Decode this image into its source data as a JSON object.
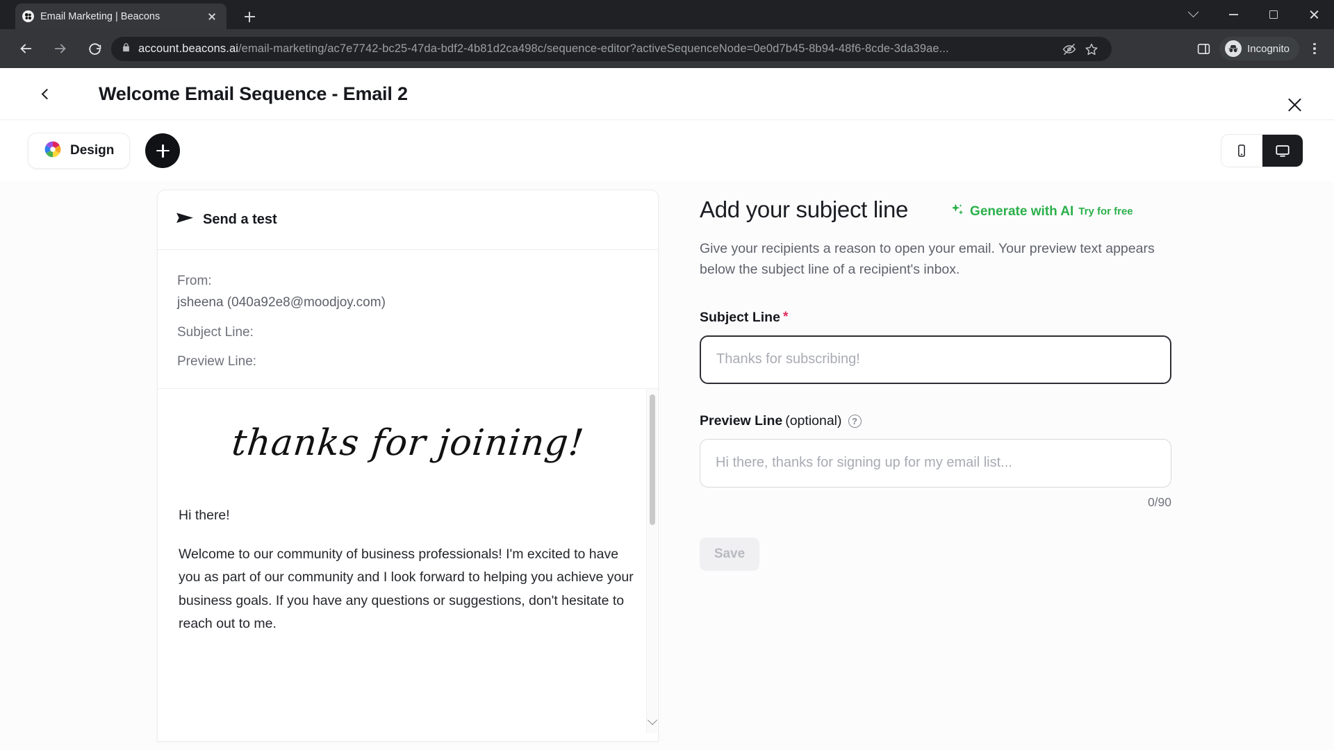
{
  "browser": {
    "tab": {
      "title": "Email Marketing | Beacons",
      "favicon": "beacons-logo-icon",
      "close": "close-tab-icon"
    },
    "new_tab": "+",
    "window_controls": {
      "minimize": "minimize-icon",
      "maximize": "maximize-icon",
      "close": "close-window-icon",
      "tab_search": "tab-search-chevron-icon"
    },
    "nav": {
      "back": "back-arrow-icon",
      "forward": "forward-arrow-icon",
      "reload": "reload-icon"
    },
    "url": {
      "host": "account.beacons.ai",
      "path": "/email-marketing/ac7e7742-bc25-47da-bdf2-4b81d2ca498c/sequence-editor?activeSequenceNode=0e0d7b45-8b94-48f6-8cde-3da39ae...",
      "lock": "lock-icon"
    },
    "omnibox_actions": {
      "tracking_off": "eye-slash-icon",
      "bookmark": "star-icon",
      "side_panel": "side-panel-icon"
    },
    "profile": {
      "label": "Incognito",
      "icon": "incognito-hat-icon"
    },
    "menu": "kebab-menu-icon"
  },
  "app": {
    "header": {
      "back": "back-chevron-icon",
      "title": "Welcome Email Sequence - Email 2",
      "close": "close-icon"
    },
    "toolbar": {
      "design_label": "Design",
      "design_icon": "color-wheel-icon",
      "add_label": "+",
      "device_mobile": "mobile-icon",
      "device_desktop": "desktop-icon",
      "active_device": "desktop"
    },
    "preview": {
      "send_test_label": "Send a test",
      "send_test_icon": "paper-plane-icon",
      "from_label": "From:",
      "from_value": "jsheena (040a92e8@moodjoy.com)",
      "subject_label": "Subject Line:",
      "preview_label": "Preview Line:",
      "hero_script": "thanks for joining!",
      "body_paragraphs": [
        "Hi there!",
        "Welcome to our community of business professionals! I'm excited to have you as part of our community and I look forward to helping you achieve your business goals. If you have any questions or suggestions, don't hesitate to reach out to me."
      ]
    },
    "form": {
      "title": "Add your subject line",
      "ai_label": "Generate with AI",
      "ai_sub": "Try for free",
      "ai_icon": "sparkles-icon",
      "description": "Give your recipients a reason to open your email. Your preview text appears below the subject line of a recipient's inbox.",
      "subject": {
        "label": "Subject Line",
        "required_mark": "*",
        "value": "",
        "placeholder": "Thanks for subscribing!"
      },
      "preview": {
        "label": "Preview Line",
        "optional": "(optional)",
        "help_icon": "question-mark-icon",
        "value": "",
        "placeholder": "Hi there, thanks for signing up for my email list...",
        "char_count": "0/90"
      },
      "save_label": "Save"
    }
  },
  "colors": {
    "accent_green": "#2bb04a",
    "required_red": "#e0295b",
    "dark": "#111215"
  }
}
